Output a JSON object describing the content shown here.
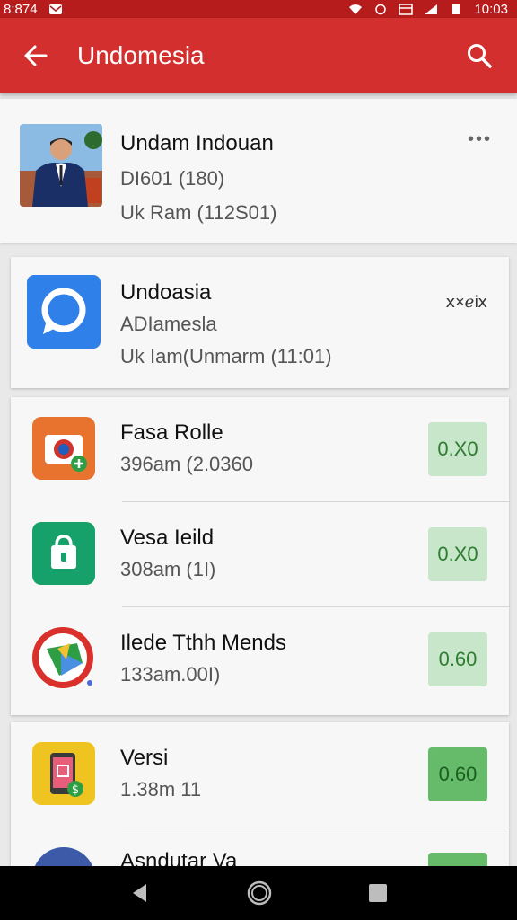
{
  "status_bar": {
    "left_text": "8:874",
    "time": "10:03"
  },
  "app_bar": {
    "title": "Undomesia"
  },
  "featured": [
    {
      "title": "Undam Indouan",
      "line1": "DI601 (180)",
      "line2": "Uk Ram (112S01)",
      "action": "•••"
    },
    {
      "title": "Undoasia",
      "line1": "ADIamesla",
      "line2": "Uk Iam(Unmarm (11:01)",
      "action": "ⅹ×ℯⅸ"
    }
  ],
  "apps": [
    {
      "title": "Fasa Rolle",
      "subtitle": "396am (2.0360",
      "price": "0.X0"
    },
    {
      "title": "Vesa Ieild",
      "subtitle": "308am (1I)",
      "price": "0.X0"
    },
    {
      "title": "Ilede Tthh Mends",
      "subtitle": "133am.00I)",
      "price": "0.60"
    }
  ],
  "apps2": [
    {
      "title": "Versi",
      "subtitle": "1.38m 11",
      "price": "0.60"
    },
    {
      "title": "Asndutar Va",
      "subtitle": "",
      "price": ""
    }
  ],
  "colors": {
    "app_bar": "#d32f2f",
    "status_bar": "#b71c1c",
    "price_bg": "#c8e6c9",
    "price_fg": "#2e7d32"
  }
}
